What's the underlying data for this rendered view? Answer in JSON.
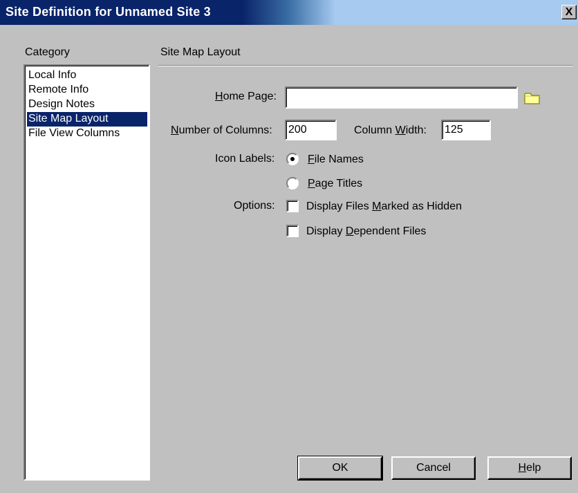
{
  "window": {
    "title": "Site Definition for Unnamed Site 3",
    "close_label": "X"
  },
  "category": {
    "heading": "Category",
    "items": [
      {
        "label": "Local Info",
        "selected": false
      },
      {
        "label": "Remote Info",
        "selected": false
      },
      {
        "label": "Design Notes",
        "selected": false
      },
      {
        "label": "Site Map Layout",
        "selected": true
      },
      {
        "label": "File View Columns",
        "selected": false
      }
    ]
  },
  "panel": {
    "heading": "Site Map Layout",
    "home_page": {
      "label_key": "H",
      "label_rest": "ome Page:",
      "value": ""
    },
    "num_columns": {
      "label_key": "N",
      "label_rest": "umber of Columns:",
      "value": "200"
    },
    "column_width": {
      "label_pre": "Column ",
      "label_key": "W",
      "label_rest": "idth:",
      "value": "125"
    },
    "icon_labels": {
      "label": "Icon Labels:",
      "file_names": {
        "key": "F",
        "rest": "ile Names",
        "checked": true
      },
      "page_titles": {
        "key": "P",
        "rest": "age Titles",
        "checked": false
      }
    },
    "options": {
      "label": "Options:",
      "hidden": {
        "pre": "Display Files ",
        "key": "M",
        "rest": "arked as Hidden",
        "checked": false
      },
      "dependent": {
        "pre": "Display ",
        "key": "D",
        "rest": "ependent Files",
        "checked": false
      }
    }
  },
  "buttons": {
    "ok": "OK",
    "cancel": "Cancel",
    "help_key": "H",
    "help_rest": "elp"
  },
  "colors": {
    "title_bar": "#0a246a",
    "selection": "#0a246a",
    "face": "#c0c0c0"
  },
  "icons": {
    "browse": "folder-icon"
  }
}
